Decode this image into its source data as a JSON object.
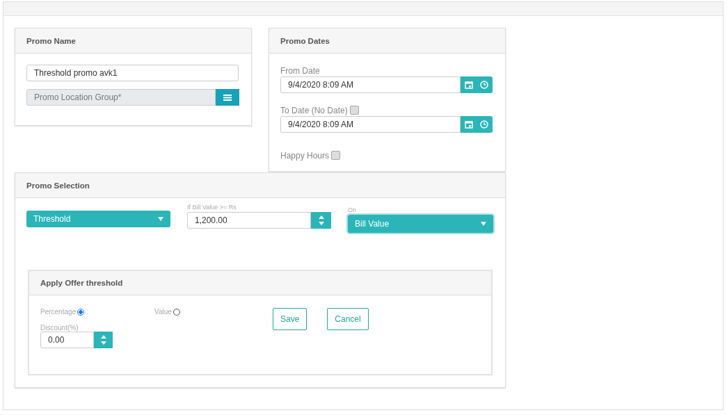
{
  "promo_name": {
    "title": "Promo Name",
    "name_value": "Threshold promo avk1",
    "location_placeholder": "Promo Location Group*"
  },
  "promo_dates": {
    "title": "Promo Dates",
    "from_label": "From Date",
    "from_value": "9/4/2020 8:09 AM",
    "to_label": "To Date (No Date)",
    "no_date_checked": false,
    "to_value": "9/4/2020 8:09 AM",
    "happy_hours_label": "Happy Hours",
    "happy_hours_checked": false
  },
  "promo_selection": {
    "title": "Promo Selection",
    "type_value": "Threshold",
    "bill_label": "If Bill Value >= Rs",
    "bill_value": "1,200.00",
    "on_label": "On",
    "on_value": "Bill Value"
  },
  "apply_offer": {
    "title": "Apply Offer threshold",
    "options": [
      {
        "label": "Percentage",
        "selected": true
      },
      {
        "label": "Value",
        "selected": false
      }
    ],
    "discount_label": "Discount(%)",
    "discount_value": "0.00",
    "buttons": [
      "Save",
      "Cancel"
    ]
  }
}
